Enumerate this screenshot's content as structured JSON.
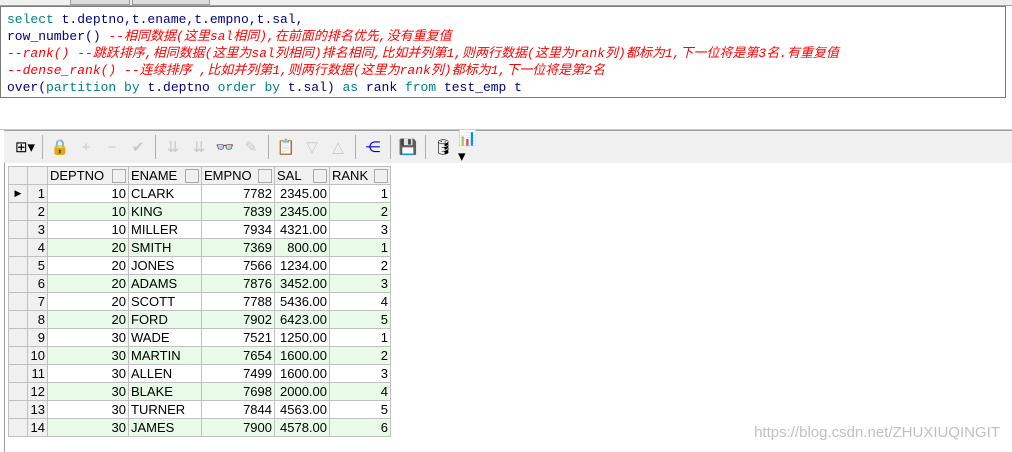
{
  "sql": [
    [
      {
        "t": "select",
        "k": "kw"
      },
      {
        "t": " t.deptno,t.ename,t.empno,t.sal,",
        "k": ""
      }
    ],
    [
      {
        "t": "row_number() ",
        "k": ""
      },
      {
        "t": "--相同数据(这里sal相同),在前面的排名优先,没有重复值",
        "k": "cm"
      }
    ],
    [
      {
        "t": "--rank() --跳跃排序,相同数据(这里为sal列相同)排名相同,比如并列第1,则两行数据(这里为rank列)都标为1,下一位将是第3名.有重复值",
        "k": "cm"
      }
    ],
    [
      {
        "t": "--dense_rank() --连续排序 ,比如并列第1,则两行数据(这里为rank列)都标为1,下一位将是第2名",
        "k": "cm"
      }
    ],
    [
      {
        "t": "over(",
        "k": ""
      },
      {
        "t": "partition by",
        "k": "kw"
      },
      {
        "t": " t.deptno ",
        "k": ""
      },
      {
        "t": "order by",
        "k": "kw"
      },
      {
        "t": " t.sal) ",
        "k": ""
      },
      {
        "t": "as",
        "k": "kw"
      },
      {
        "t": " rank ",
        "k": ""
      },
      {
        "t": "from",
        "k": "kw"
      },
      {
        "t": " test_emp t",
        "k": ""
      }
    ]
  ],
  "grid": {
    "columns": [
      "DEPTNO",
      "ENAME",
      "EMPNO",
      "SAL",
      "RANK"
    ],
    "rows": [
      [
        "10",
        "CLARK",
        "7782",
        "2345.00",
        "1"
      ],
      [
        "10",
        "KING",
        "7839",
        "2345.00",
        "2"
      ],
      [
        "10",
        "MILLER",
        "7934",
        "4321.00",
        "3"
      ],
      [
        "20",
        "SMITH",
        "7369",
        "800.00",
        "1"
      ],
      [
        "20",
        "JONES",
        "7566",
        "1234.00",
        "2"
      ],
      [
        "20",
        "ADAMS",
        "7876",
        "3452.00",
        "3"
      ],
      [
        "20",
        "SCOTT",
        "7788",
        "5436.00",
        "4"
      ],
      [
        "20",
        "FORD",
        "7902",
        "6423.00",
        "5"
      ],
      [
        "30",
        "WADE",
        "7521",
        "1250.00",
        "1"
      ],
      [
        "30",
        "MARTIN",
        "7654",
        "1600.00",
        "2"
      ],
      [
        "30",
        "ALLEN",
        "7499",
        "1600.00",
        "3"
      ],
      [
        "30",
        "BLAKE",
        "7698",
        "2000.00",
        "4"
      ],
      [
        "30",
        "TURNER",
        "7844",
        "4563.00",
        "5"
      ],
      [
        "30",
        "JAMES",
        "7900",
        "4578.00",
        "6"
      ]
    ]
  },
  "watermark": "https://blog.csdn.net/ZHUXIUQINGIT"
}
